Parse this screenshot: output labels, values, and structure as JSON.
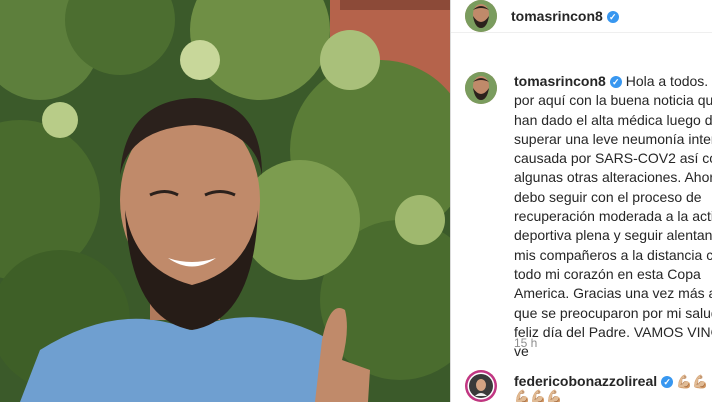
{
  "post": {
    "author": {
      "username": "tomasrincon8",
      "verified_icon": "verified-badge-icon",
      "avatar": "profile-avatar"
    },
    "caption": {
      "username": "tomasrincon8",
      "text": "Hola a todos. Pa\npor aquí con la buena noticia que\nhan dado el alta médica luego de\nsuperar una leve neumonía inters\ncausada por SARS-COV2 así como\nalgunas otras alteraciones. Ahora\ndebo seguir con el proceso de\nrecuperación moderada a la activi\ndeportiva plena y seguir alentand\nmis compañeros a la distancia con\ntodo mi corazón en esta Copa\nAmerica. Gracias una vez más a lo\nque se preocuparon por mi salud\nfeliz día del Padre. VAMOS VINOT\nve"
    },
    "timestamp": "15 h"
  },
  "comment": {
    "username": "federicobonazzolireal",
    "verified_icon": "verified-badge-icon",
    "emojis": "💪🏼💪🏼",
    "emojis_line2": "💪🏼💪🏼💪🏼"
  },
  "colors": {
    "verified": "#3897f0",
    "text": "#262626",
    "muted": "#8e8e8e"
  }
}
